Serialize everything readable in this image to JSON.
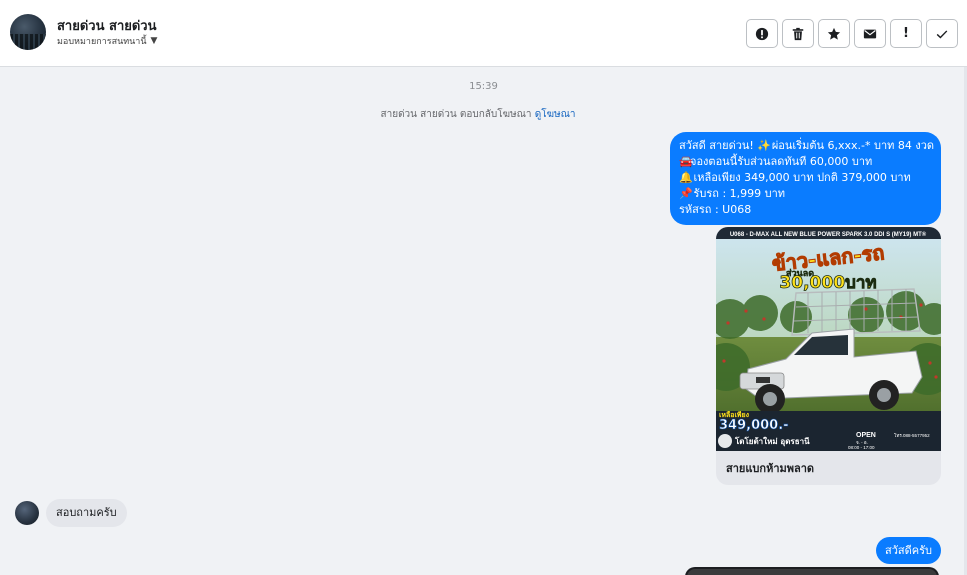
{
  "header": {
    "contact_name": "สายด่วน สายด่วน",
    "assign_label": "มอบหมายการสนทนานี้",
    "actions": [
      {
        "name": "spam-button",
        "icon": "alert-circle-icon"
      },
      {
        "name": "delete-button",
        "icon": "trash-icon"
      },
      {
        "name": "star-button",
        "icon": "star-icon"
      },
      {
        "name": "mark-unread-button",
        "icon": "envelope-icon"
      },
      {
        "name": "follow-up-button",
        "icon": "exclamation-icon",
        "glyph": "!"
      },
      {
        "name": "done-button",
        "icon": "check-icon"
      }
    ]
  },
  "chat": {
    "timestamp": "15:39",
    "system_text": "สายด่วน สายด่วน ตอบกลับโฆษณา",
    "system_link": "ดูโฆษณา",
    "ad_message": {
      "lines": [
        {
          "icon": "",
          "text": "สวัสดี สายด่วน! "
        },
        {
          "icon": "🚘",
          "text": "จองตอนนี้รับส่วนลดทันที 60,000 บาท"
        },
        {
          "icon": "🔔",
          "text": " เหลือเพียง 349,000 บาท ปกติ 379,000 บาท"
        },
        {
          "icon": "📌",
          "text": " รับรถ : 1,999 บาท"
        },
        {
          "icon": "",
          "text": "รหัสรถ : U068"
        }
      ],
      "line1_sparkle": "✨",
      "line1_tail": " ผ่อนเริ่มต้น 6,xxx.-* บาท 84 งวด"
    },
    "ad_card": {
      "image": {
        "top_banner": "U068 - D-MAX ALL NEW BLUE POWER SPARK 3.0 DDI S (MY19) MT®",
        "headline": "ข้าว-แลก-รถ",
        "discount_label": "ส่วนลด",
        "discount_value": "30,000บาท",
        "price_label": "เหลือเพียง",
        "price": "349,000.-",
        "dealer": "โตโยต้าใหม่ อุดรธานี",
        "open_label": "OPEN",
        "open_days": "จ. - อ.",
        "open_hours": "08:00 - 17:00",
        "phone": "โทร.088-5577952"
      },
      "title": "สายแบกห้ามพลาด"
    },
    "incoming_text": "สอบถามครับ",
    "reply_text": "สวัสดีครับ"
  },
  "colors": {
    "outgoing_bubble": "#0a7cff",
    "incoming_bubble": "#e4e6eb",
    "chat_background": "#f0f2f5",
    "link": "#1565c0"
  }
}
